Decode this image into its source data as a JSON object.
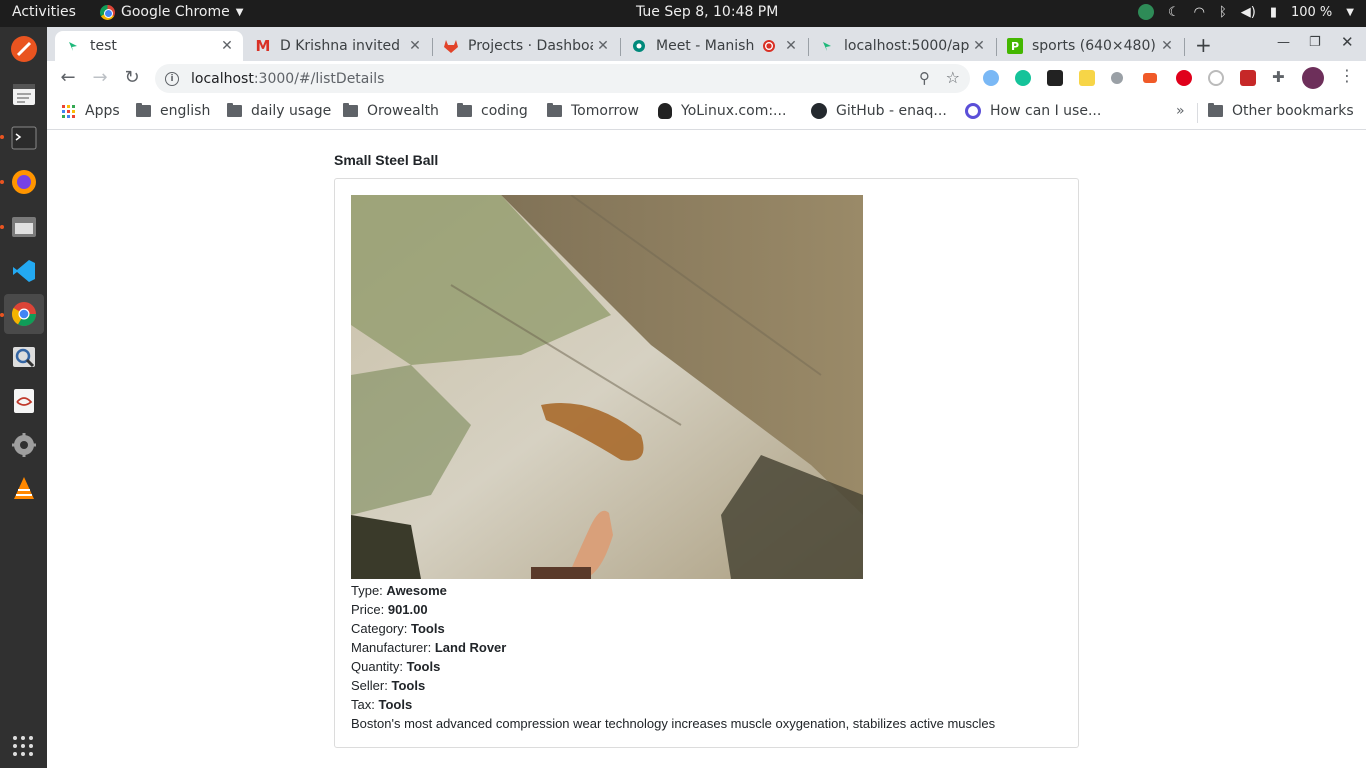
{
  "system": {
    "activities": "Activities",
    "app_name": "Google Chrome",
    "clock": "Tue Sep  8, 10:48 PM",
    "battery": "100 %"
  },
  "tabs": [
    {
      "title": "test",
      "active": true
    },
    {
      "title": "D Krishna invited y"
    },
    {
      "title": "Projects · Dashboa"
    },
    {
      "title": "Meet - Manish"
    },
    {
      "title": "localhost:5000/ap"
    },
    {
      "title": "sports (640×480)"
    }
  ],
  "omnibox": {
    "host": "localhost",
    "path": ":3000/#/listDetails"
  },
  "bookmarks": [
    {
      "label": "Apps"
    },
    {
      "label": "english"
    },
    {
      "label": "daily usage"
    },
    {
      "label": "Orowealth"
    },
    {
      "label": "coding"
    },
    {
      "label": "Tomorrow"
    },
    {
      "label": "YoLinux.com:..."
    },
    {
      "label": "GitHub - enaq..."
    },
    {
      "label": "How can I use..."
    }
  ],
  "bookmarks_overflow": "»",
  "other_bookmarks": "Other bookmarks",
  "product": {
    "title": "Small Steel Ball",
    "fields": [
      {
        "label": "Type: ",
        "value": "Awesome"
      },
      {
        "label": "Price: ",
        "value": "901.00"
      },
      {
        "label": "Category: ",
        "value": "Tools"
      },
      {
        "label": "Manufacturer: ",
        "value": "Land Rover"
      },
      {
        "label": "Quantity: ",
        "value": "Tools"
      },
      {
        "label": "Seller: ",
        "value": "Tools"
      },
      {
        "label": "Tax: ",
        "value": "Tools"
      }
    ],
    "description": "Boston's most advanced compression wear technology increases muscle oxygenation, stabilizes active muscles"
  }
}
